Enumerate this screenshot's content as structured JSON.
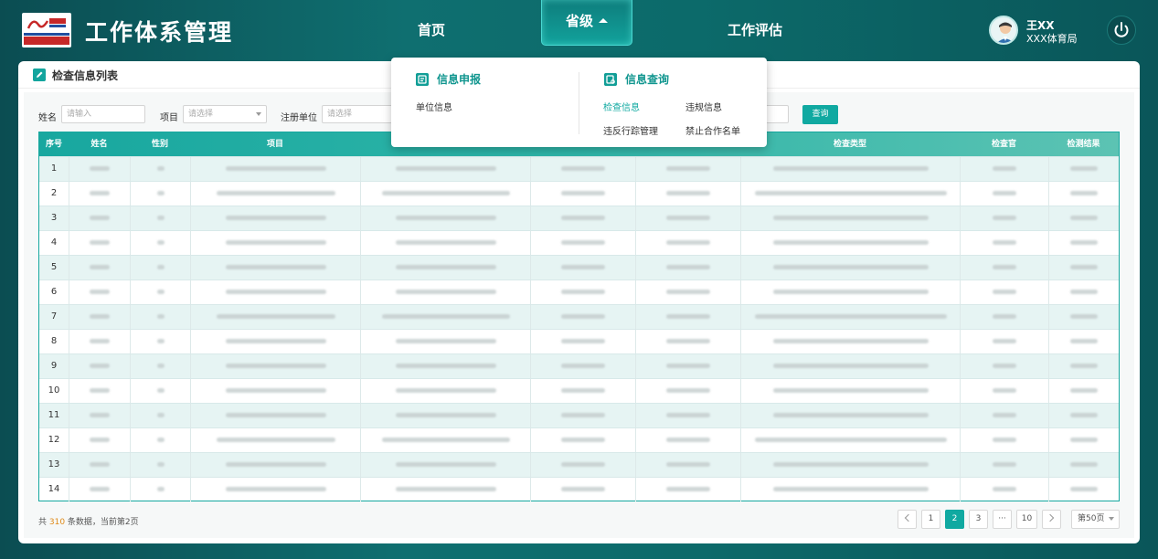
{
  "header": {
    "app_title": "工作体系管理",
    "nav": [
      {
        "label": "首页"
      },
      {
        "label": "省级"
      },
      {
        "label": "工作评估"
      }
    ],
    "user": {
      "name": "王XX",
      "org": "XXX体育局"
    }
  },
  "dropdown": {
    "groups": [
      {
        "title": "信息申报",
        "items": [
          "单位信息"
        ]
      },
      {
        "title": "信息查询",
        "items": [
          "检查信息",
          "违规信息",
          "违反行踪管理",
          "禁止合作名单"
        ]
      }
    ],
    "active_item": "检查信息"
  },
  "card": {
    "title": "检查信息列表"
  },
  "filters": {
    "name_label": "姓名",
    "name_placeholder": "请输入",
    "project_label": "项目",
    "project_placeholder": "请选择",
    "unit_label": "注册单位",
    "unit_placeholder": "请选择",
    "query_label": "查询"
  },
  "table": {
    "columns": [
      "序号",
      "姓名",
      "性别",
      "项目",
      "",
      "",
      "",
      "检查类型",
      "检查官",
      "检测结果"
    ],
    "rows": [
      "1",
      "2",
      "3",
      "4",
      "5",
      "6",
      "7",
      "8",
      "9",
      "10",
      "11",
      "12",
      "13",
      "14"
    ]
  },
  "pagination": {
    "total_prefix": "共 ",
    "total": "310",
    "total_suffix": " 条数据，当前第2页",
    "pages": [
      "1",
      "2",
      "3",
      "···",
      "10"
    ],
    "current": "2",
    "page_size": "第50页"
  },
  "colors": {
    "accent": "#10a9a1",
    "header_bg": "#0f6f70",
    "highlight": "#e08a18"
  }
}
